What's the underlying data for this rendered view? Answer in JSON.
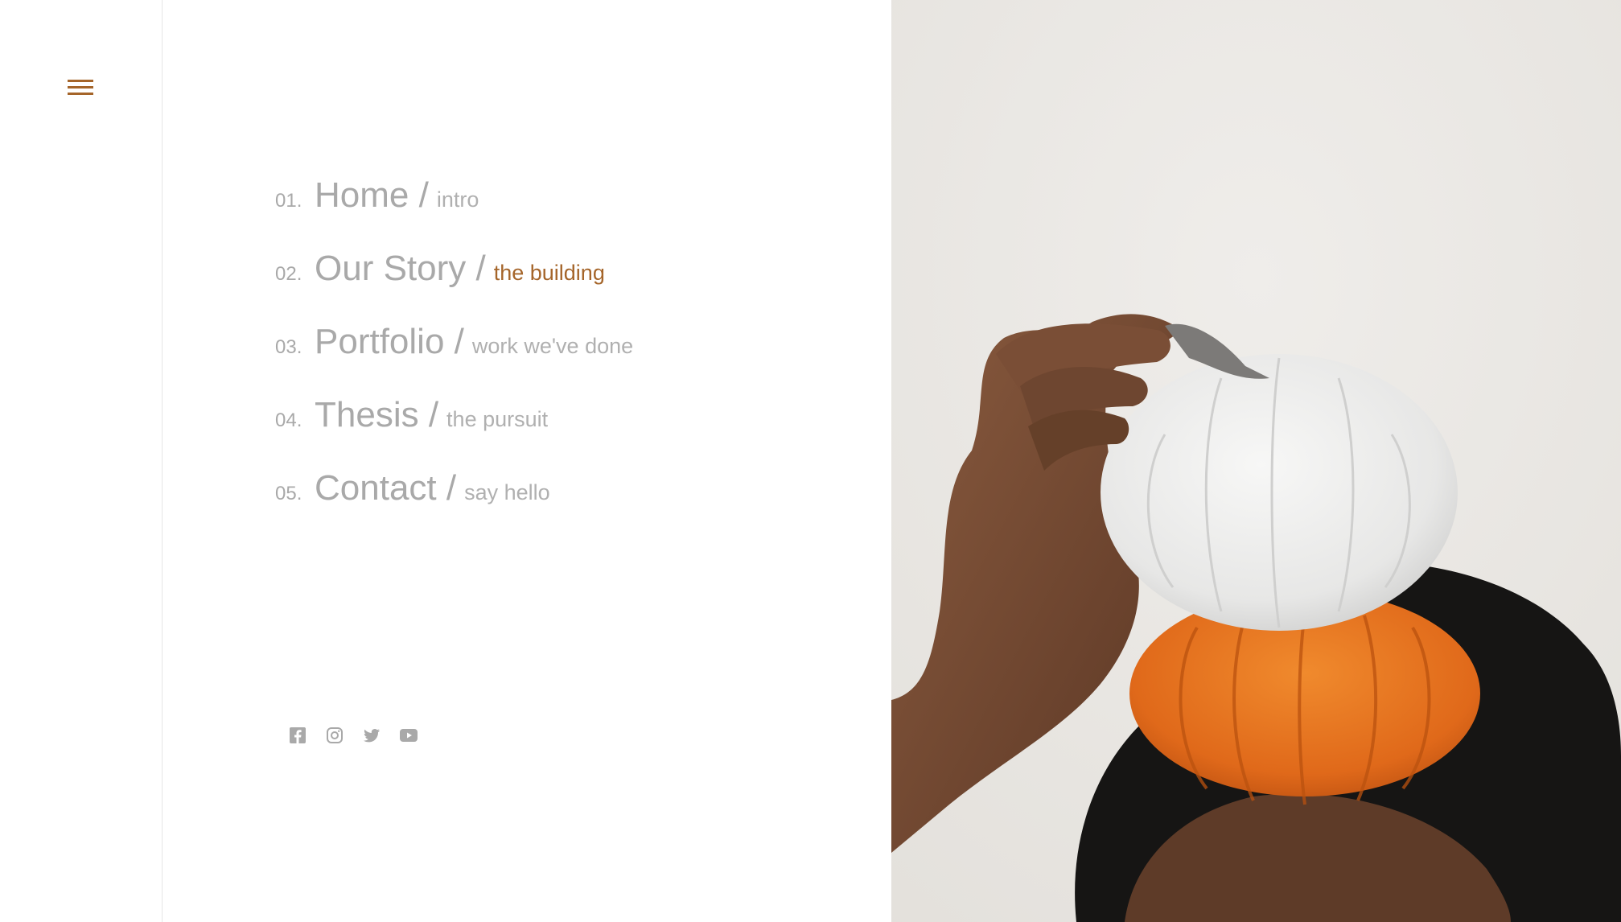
{
  "sidebar": {
    "menu_icon": "hamburger-menu-icon"
  },
  "menu": {
    "items": [
      {
        "number": "01.",
        "title": "Home /",
        "subtitle": "intro"
      },
      {
        "number": "02.",
        "title": "Our Story /",
        "subtitle": "the building",
        "active": true
      },
      {
        "number": "03.",
        "title": "Portfolio /",
        "subtitle": "work we've done"
      },
      {
        "number": "04.",
        "title": "Thesis /",
        "subtitle": "the pursuit"
      },
      {
        "number": "05.",
        "title": "Contact /",
        "subtitle": "say hello"
      }
    ]
  },
  "social": {
    "icons": [
      "facebook-icon",
      "instagram-icon",
      "twitter-icon",
      "youtube-icon"
    ]
  },
  "photo": {
    "subject": "hand-holding-pumpkins-image"
  },
  "colors": {
    "accent": "#a5652a",
    "muted_text": "#a9a9a9",
    "pumpkin_orange": "#e4701e"
  }
}
